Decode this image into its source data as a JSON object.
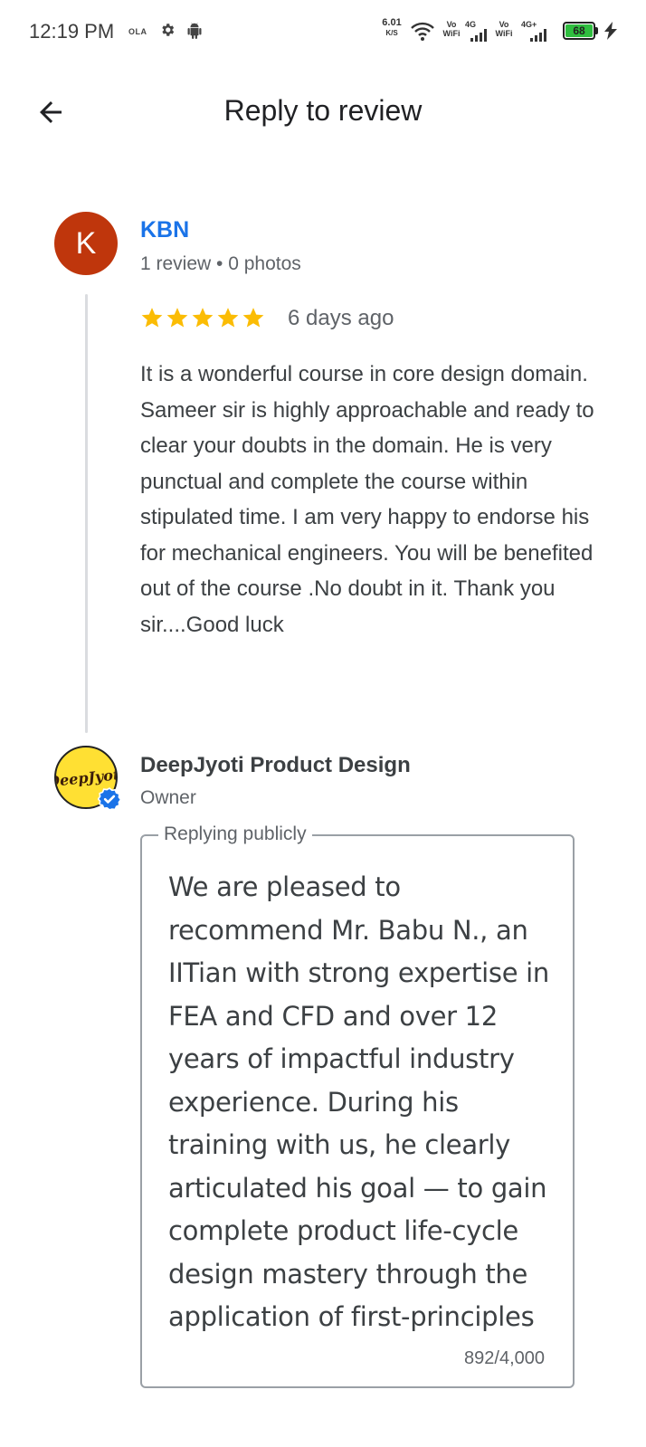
{
  "status_bar": {
    "time": "12:19 PM",
    "carrier_icon_text": "OLA",
    "net_speed_value": "6.01",
    "net_speed_unit": "K/S",
    "vo_wifi_1": "Vo WiFi",
    "network_1": "4G",
    "vo_wifi_2": "Vo WiFi",
    "network_2": "4G+",
    "battery_level": "68",
    "icons": [
      "gear-icon",
      "android-icon",
      "wifi-icon",
      "signal-icon",
      "battery-icon",
      "charging-bolt-icon"
    ]
  },
  "header": {
    "title": "Reply to review",
    "back_icon": "arrow-left-icon"
  },
  "review": {
    "avatar_letter": "K",
    "avatar_color": "#bf360c",
    "reviewer_name": "KBN",
    "reviewer_meta": "1 review • 0 photos",
    "rating": 5,
    "date": "6 days ago",
    "text": "It is a wonderful course in core design domain. Sameer sir is highly approachable and ready to clear your doubts in the domain. He is very punctual and complete the course within stipulated time. I am very happy to endorse his for mechanical engineers. You will be benefited out of the course .No doubt in it. Thank you sir....Good luck"
  },
  "owner": {
    "logo_text": "DeepJyoti",
    "name": "DeepJyoti Product Design",
    "role": "Owner",
    "verified_icon": "verified-badge-icon"
  },
  "reply": {
    "label": "Replying publicly",
    "text": "We are pleased to recommend Mr. Babu N., an IITian with strong expertise in FEA and CFD and over 12 years of impactful industry experience. During his training with us, he clearly articulated his goal — to gain complete product life-cycle design mastery through the application of first-principles",
    "counter": "892/4,000"
  },
  "colors": {
    "link_blue": "#1a73e8",
    "star_yellow": "#fbbc04",
    "battery_green": "#2fbe3f"
  }
}
